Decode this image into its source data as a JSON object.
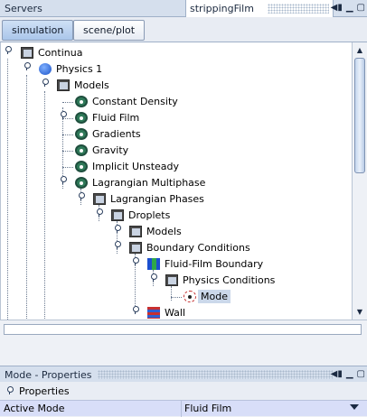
{
  "servers_panel": {
    "title": "Servers",
    "tab_title": "strippingFilm"
  },
  "tabs": [
    {
      "label": "simulation",
      "active": true
    },
    {
      "label": "scene/plot",
      "active": false
    }
  ],
  "tree": [
    {
      "label": "Continua",
      "icon": "folder-icon"
    },
    {
      "label": "Physics 1",
      "icon": "physics-continuum-icon"
    },
    {
      "label": "Models",
      "icon": "folder-icon"
    },
    {
      "label": "Constant Density",
      "icon": "model-icon"
    },
    {
      "label": "Fluid Film",
      "icon": "model-icon"
    },
    {
      "label": "Gradients",
      "icon": "model-icon"
    },
    {
      "label": "Gravity",
      "icon": "model-icon"
    },
    {
      "label": "Implicit Unsteady",
      "icon": "model-icon"
    },
    {
      "label": "Lagrangian Multiphase",
      "icon": "model-icon"
    },
    {
      "label": "Lagrangian Phases",
      "icon": "folder-icon"
    },
    {
      "label": "Droplets",
      "icon": "folder-icon"
    },
    {
      "label": "Models",
      "icon": "folder-icon"
    },
    {
      "label": "Boundary Conditions",
      "icon": "folder-icon"
    },
    {
      "label": "Fluid-Film Boundary",
      "icon": "boundary-icon"
    },
    {
      "label": "Physics Conditions",
      "icon": "folder-icon"
    },
    {
      "label": "Mode",
      "icon": "mode-icon",
      "selected": true
    },
    {
      "label": "Wall",
      "icon": "wall-icon"
    }
  ],
  "properties": {
    "title": "Mode - Properties",
    "header": "Properties",
    "rows": [
      {
        "name": "Active Mode",
        "value": "Fluid Film"
      }
    ]
  }
}
